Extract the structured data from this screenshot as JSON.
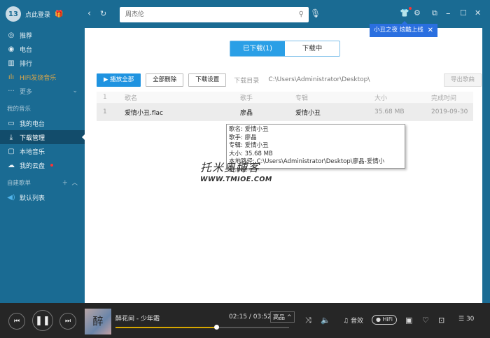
{
  "sidebar": {
    "user": {
      "login_label": "点此登录",
      "avatar_text": "13"
    },
    "items": [
      {
        "label": "推荐",
        "icon": "disc-icon"
      },
      {
        "label": "电台",
        "icon": "radio-icon"
      },
      {
        "label": "排行",
        "icon": "chart-icon"
      },
      {
        "label": "HiFi发烧音乐",
        "icon": "waveform-icon"
      },
      {
        "label": "更多",
        "icon": "more-icon"
      }
    ],
    "my_music_title": "我的音乐",
    "my_items": [
      {
        "label": "我的电台"
      },
      {
        "label": "下载管理",
        "active": true
      },
      {
        "label": "本地音乐"
      },
      {
        "label": "我的云盘"
      }
    ],
    "playlist_title": "自建歌单",
    "playlists": [
      {
        "label": "默认列表"
      }
    ]
  },
  "header": {
    "search_value": "周杰伦",
    "notice": "小丑之夜 炫酷上线"
  },
  "main": {
    "tabs": [
      {
        "label": "已下载(1)",
        "active": true
      },
      {
        "label": "下载中"
      }
    ],
    "toolbar": {
      "play_all": "播放全部",
      "delete_all": "全部删除",
      "settings": "下载设置",
      "dir_label": "下载目录",
      "dir_path": "C:\\Users\\Administrator\\Desktop\\",
      "export": "导出歌曲"
    },
    "table": {
      "headers": [
        "1",
        "歌名",
        "歌手",
        "专辑",
        "大小",
        "完成时间"
      ],
      "rows": [
        [
          "1",
          "爱情小丑.flac",
          "廖晶",
          "爱情小丑",
          "35.68 MB",
          "2019-09-30"
        ]
      ]
    },
    "tooltip": [
      "歌名: 爱情小丑",
      "歌手: 廖晶",
      "专辑: 爱情小丑",
      "大小: 35.68 MB",
      "本地路径: C:\\Users\\Administrator\\Desktop\\廖晶-爱情小丑.flac"
    ]
  },
  "watermark": {
    "line1": "托米奥博客",
    "line2": "WWW.TMIOE.COM"
  },
  "player": {
    "song": "醉花间 - 少年霜",
    "cover_text": "醉",
    "time": "02:15 / 03:52",
    "progress": 0.58,
    "quality": "高品 ^",
    "effect": "音效",
    "hifi": "HiFi",
    "queue_count": "30"
  },
  "colors": {
    "sidebar": "#1a6b93",
    "accent": "#1f93e0",
    "player": "#262626",
    "progress": "#d6a600"
  }
}
